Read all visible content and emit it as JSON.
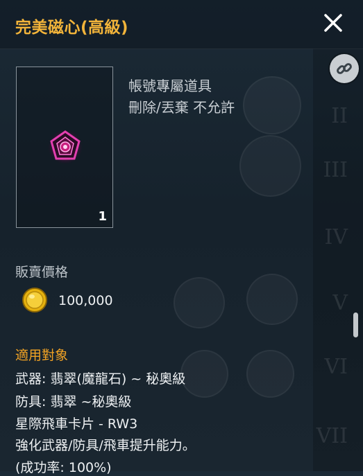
{
  "window": {
    "title": "完美磁心(高級)"
  },
  "item": {
    "quantity": "1",
    "attributes": [
      "帳號專屬道具",
      "刪除/丟棄 不允許"
    ]
  },
  "sell": {
    "label": "販賣價格",
    "price": "100,000"
  },
  "target": {
    "title": "適用對象",
    "lines": [
      "武器: 翡翠(魔龍石) ~ 秘奧級",
      "防具: 翡翠 ~秘奧級",
      "星際飛車卡片 - RW3",
      "強化武器/防具/飛車提升能力。",
      "(成功率: 100%)"
    ]
  },
  "colors": {
    "title": "#f2b43a",
    "section_heading": "#f2a324",
    "coin": "#e6b20e"
  },
  "icons": {
    "close": "close-icon",
    "link": "link-icon",
    "coin": "gold-coin-icon",
    "item": "magnetic-core-gem-icon"
  }
}
